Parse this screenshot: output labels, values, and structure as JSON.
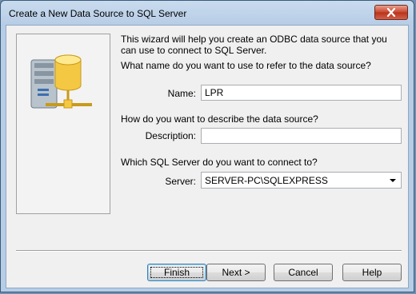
{
  "window": {
    "title": "Create a New Data Source to SQL Server"
  },
  "intro": "This wizard will help you create an ODBC data source that you can use to connect to SQL Server.",
  "name_question": "What name do you want to use to refer to the data source?",
  "name_label": "Name:",
  "name_value": "LPR",
  "description_question": "How do you want to describe the data source?",
  "description_label": "Description:",
  "description_value": "",
  "server_question": "Which SQL Server do you want to connect to?",
  "server_label": "Server:",
  "server_value": "SERVER-PC\\SQLEXPRESS",
  "buttons": {
    "finish": "Finish",
    "next": "Next >",
    "cancel": "Cancel",
    "help": "Help"
  }
}
